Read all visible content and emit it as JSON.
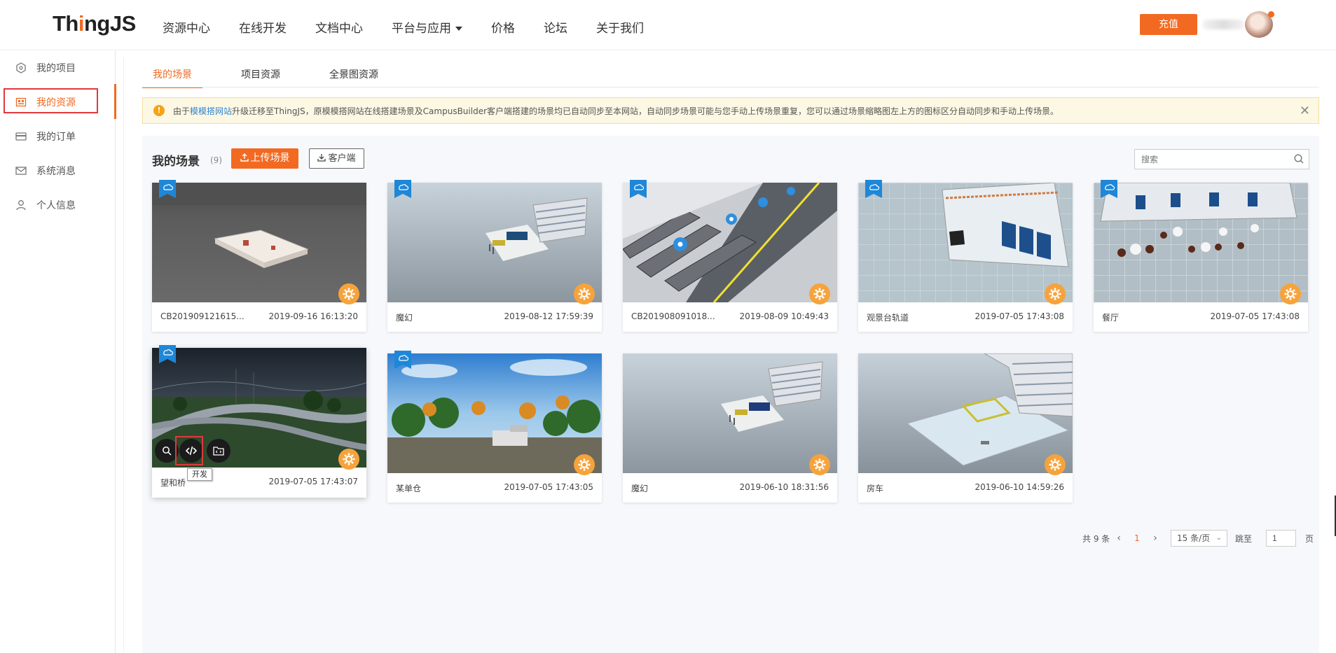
{
  "header": {
    "logo_pre": "Th",
    "logo_hl": "i",
    "logo_post": "ngJS",
    "nav": [
      "资源中心",
      "在线开发",
      "文档中心",
      "平台与应用",
      "价格",
      "论坛",
      "关于我们"
    ],
    "recharge": "充值"
  },
  "sidebar": {
    "items": [
      {
        "label": "我的项目",
        "icon": "hexagon-icon"
      },
      {
        "label": "我的资源",
        "icon": "resource-icon"
      },
      {
        "label": "我的订单",
        "icon": "card-icon"
      },
      {
        "label": "系统消息",
        "icon": "mail-icon"
      },
      {
        "label": "个人信息",
        "icon": "user-icon"
      }
    ]
  },
  "tabs": [
    "我的场景",
    "项目资源",
    "全景图资源"
  ],
  "notice": {
    "pre": "由于",
    "link": "模模搭网站",
    "post": "升级迁移至ThingJS，原模模搭网站在线搭建场景及CampusBuilder客户端搭建的场景均已自动同步至本网站，自动同步场景可能与您手动上传场景重复，您可以通过场景缩略图左上方的图标区分自动同步和手动上传场景。",
    "close": "✕"
  },
  "panel": {
    "title": "我的场景",
    "count": "(9)",
    "upload": "上传场景",
    "client": "客户端",
    "search_placeholder": "搜索"
  },
  "cards": [
    {
      "name": "CB201909121615...",
      "date": "2019-09-16 16:13:20"
    },
    {
      "name": "魔幻",
      "date": "2019-08-12 17:59:39"
    },
    {
      "name": "CB201908091018...",
      "date": "2019-08-09 10:49:43"
    },
    {
      "name": "观景台轨道",
      "date": "2019-07-05 17:43:08"
    },
    {
      "name": "餐厅",
      "date": "2019-07-05 17:43:08"
    },
    {
      "name": "望和桥",
      "date": "2019-07-05 17:43:07"
    },
    {
      "name": "某单仓",
      "date": "2019-07-05 17:43:05"
    },
    {
      "name": "魔幻",
      "date": "2019-06-10 18:31:56"
    },
    {
      "name": "房车",
      "date": "2019-06-10 14:59:26"
    }
  ],
  "tooltip": "开发",
  "pagination": {
    "total": "共 9 条",
    "page": "1",
    "size": "15 条/页",
    "jump_label": "跳至",
    "jump_value": "1",
    "page_unit": "页"
  },
  "colors": {
    "accent": "#f26a21",
    "link": "#2f83d6",
    "badge": "#1e87d8",
    "gear": "#f6a33c",
    "highlight_border": "#e0393e"
  }
}
